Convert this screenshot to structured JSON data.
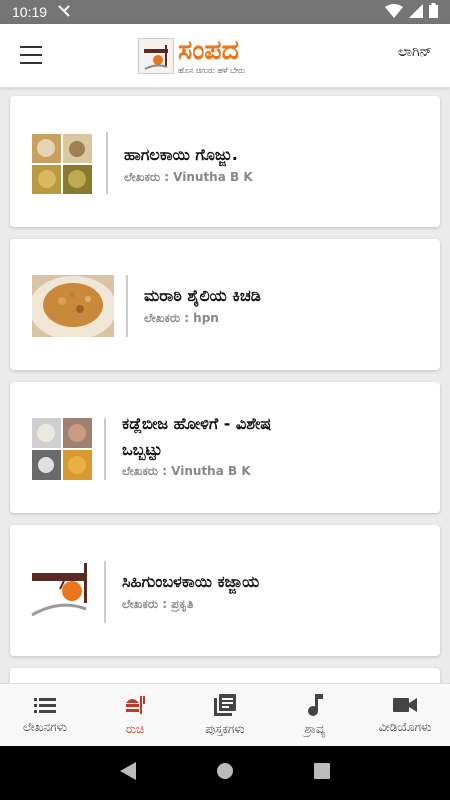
{
  "status": {
    "time": "10:19"
  },
  "header": {
    "logo_title": "ಸಂಪದ",
    "logo_tagline": "ಹೊಸ ಚಿಗುರು ಹಳೆ ಬೇರು",
    "login_label": "ಲಾಗಿನ್"
  },
  "articles": [
    {
      "title": "ಹಾಗಲಕಾಯಿ ಗೊಜ್ಜು.",
      "author": "ಲೇಖಕರು : Vinutha B K"
    },
    {
      "title": "ಮರಾಠಿ ಶೈಲಿಯ ಕಿಚಡಿ",
      "author": "ಲೇಖಕರು : hpn"
    },
    {
      "title_line1": "ಕಡ್ಲೆಬೀಜ ಹೋಳಿಗೆ - ವಿಶೇಷ",
      "title_line2": "ಒಬ್ಬಟ್ಟು",
      "author": "ಲೇಖಕರು : Vinutha B K"
    },
    {
      "title": "ಸಿಹಿಗುಂಬಳಕಾಯಿ ಕಜ್ಜಾಯ",
      "author": "ಲೇಖಕರು : ಪ್ರಕೃತಿ"
    }
  ],
  "bottom_nav": {
    "items": [
      {
        "label": "ಲೇಖನಗಳು",
        "icon": "list-icon"
      },
      {
        "label": "ರುಚಿ",
        "icon": "food-icon",
        "active": true
      },
      {
        "label": "ಪುಸ್ತಕಗಳು",
        "icon": "books-icon"
      },
      {
        "label": "ಶ್ರಾವ್ಯ",
        "icon": "music-note-icon"
      },
      {
        "label": "ವೀಡಿಯೊಗಳು",
        "icon": "video-camera-icon"
      }
    ]
  },
  "colors": {
    "accent": "#e8761f",
    "active_nav": "#c0392b",
    "status_bar": "#757575"
  }
}
